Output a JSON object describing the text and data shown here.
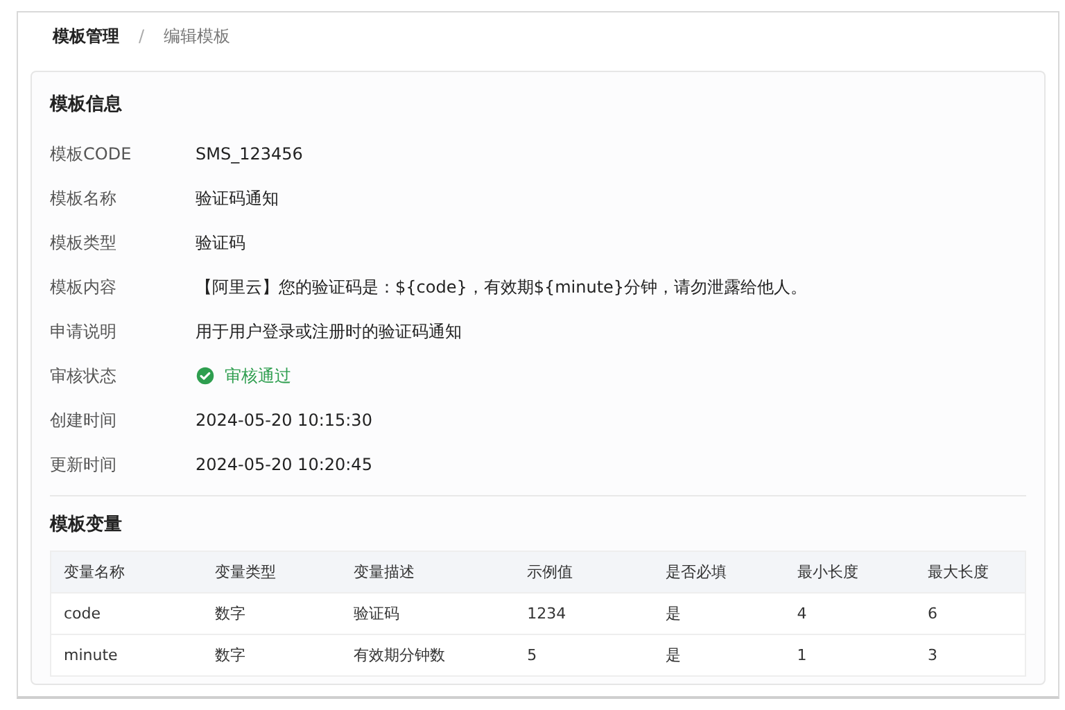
{
  "breadcrumb": [
    {
      "label": "模板管理",
      "selected": false
    },
    {
      "label": "编辑模板",
      "selected": true
    }
  ],
  "breadcrumb_separator": "/",
  "info": {
    "title": "模板信息",
    "fields": [
      {
        "label": "模板CODE",
        "value": "SMS_123456"
      },
      {
        "label": "模板名称",
        "value": "验证码通知"
      },
      {
        "label": "模板类型",
        "value": "验证码"
      },
      {
        "label": "模板内容",
        "value": "【阿里云】您的验证码是：${code}，有效期${minute}分钟，请勿泄露给他人。"
      },
      {
        "label": "申请说明",
        "value": "用于用户登录或注册时的验证码通知"
      },
      {
        "label": "审核状态",
        "value": "审核通过",
        "kind": "status"
      },
      {
        "label": "创建时间",
        "value": "2024-05-20 10:15:30"
      },
      {
        "label": "更新时间",
        "value": "2024-05-20 10:20:45"
      }
    ]
  },
  "variables": {
    "title": "模板变量",
    "columns": [
      "变量名称",
      "变量类型",
      "变量描述",
      "示例值",
      "是否必填",
      "最小长度",
      "最大长度"
    ],
    "rows": [
      [
        "code",
        "数字",
        "验证码",
        "1234",
        "是",
        "4",
        "6"
      ],
      [
        "minute",
        "数字",
        "有效期分钟数",
        "5",
        "是",
        "1",
        "3"
      ]
    ]
  }
}
